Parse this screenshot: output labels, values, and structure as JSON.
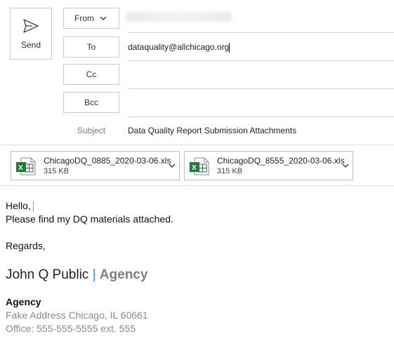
{
  "compose": {
    "send_label": "Send",
    "from_label": "From",
    "to_label": "To",
    "cc_label": "Cc",
    "bcc_label": "Bcc",
    "subject_label": "Subject",
    "to_value": "dataquality@allchicago.org",
    "subject_value": "Data Quality Report Submission Attachments"
  },
  "attachments": [
    {
      "name": "ChicagoDQ_0885_2020-03-06.xls",
      "size": "315 KB"
    },
    {
      "name": "ChicagoDQ_8555_2020-03-06.xls",
      "size": "315 KB"
    }
  ],
  "message": {
    "greeting": "Hello,",
    "line1": "Please find my DQ materials attached.",
    "closing": "Regards,"
  },
  "signature": {
    "name": "John Q Public",
    "separator": "|",
    "agency_inline": "Agency",
    "agency": "Agency",
    "address": "Fake Address Chicago, IL 60661",
    "office": "Office: 555-555-5555 ext. 555"
  },
  "colors": {
    "excel_green": "#1f7a3d",
    "signature_separator": "#2f8fd8"
  }
}
